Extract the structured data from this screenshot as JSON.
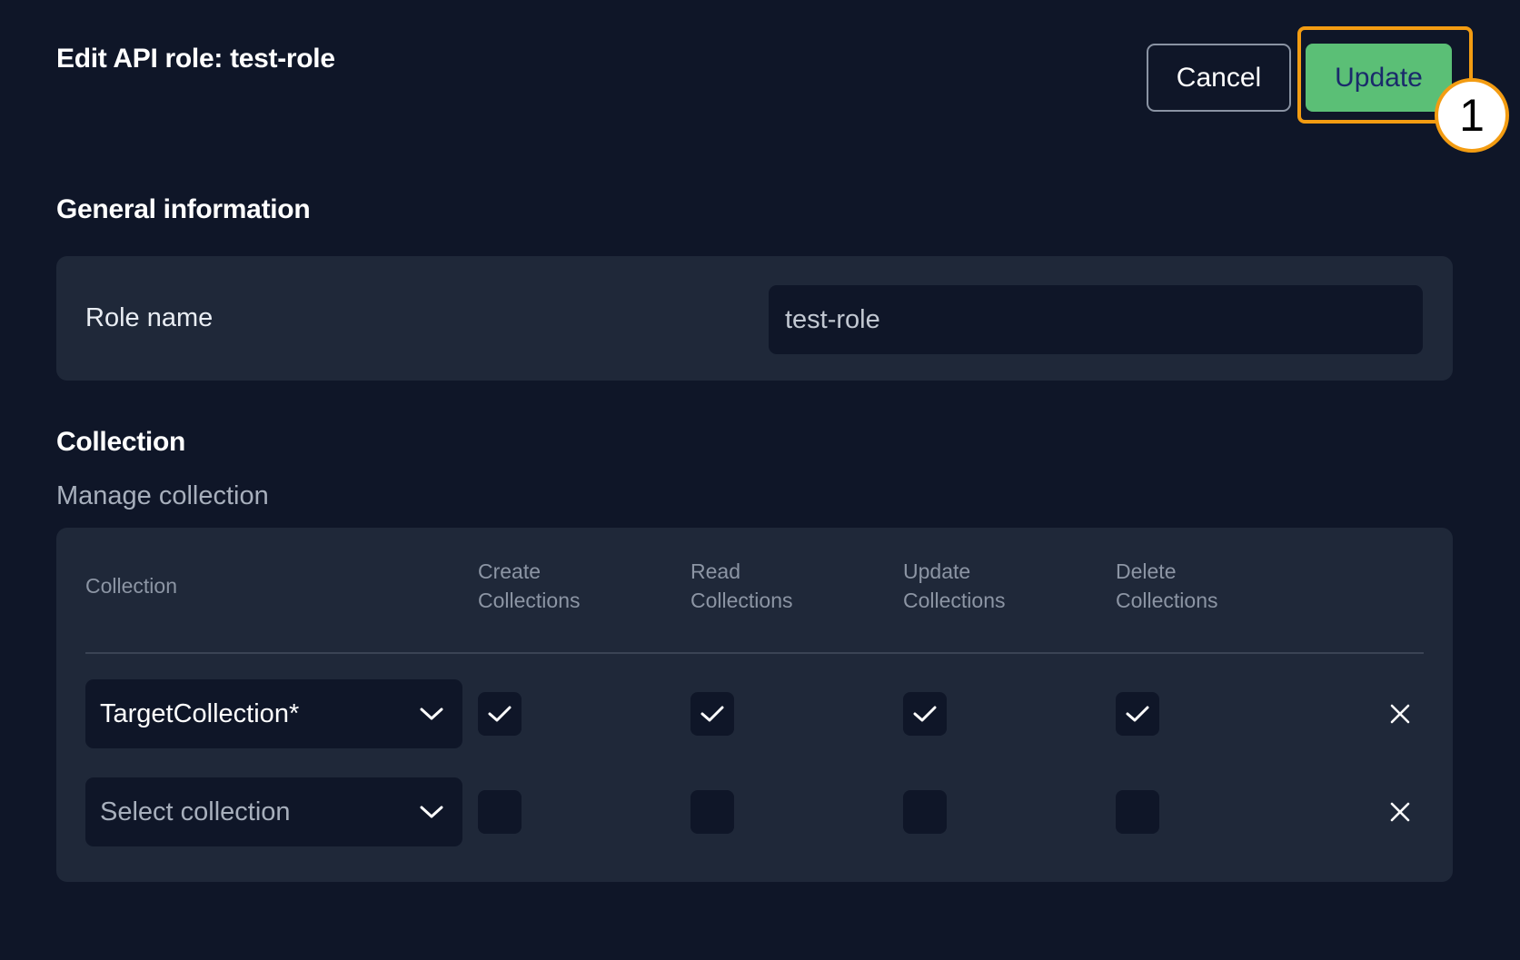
{
  "header": {
    "title": "Edit API role: test-role",
    "cancel_label": "Cancel",
    "update_label": "Update",
    "callout_number": "1"
  },
  "general": {
    "title": "General information",
    "role_name_label": "Role name",
    "role_name_value": "test-role"
  },
  "collection": {
    "title": "Collection",
    "subtitle": "Manage collection",
    "columns": {
      "collection": "Collection",
      "create_line1": "Create",
      "create_line2": "Collections",
      "read_line1": "Read",
      "read_line2": "Collections",
      "update_line1": "Update",
      "update_line2": "Collections",
      "delete_line1": "Delete",
      "delete_line2": "Collections"
    },
    "rows": [
      {
        "collection": "TargetCollection*",
        "create": true,
        "read": true,
        "update": true,
        "delete": true
      },
      {
        "collection": "Select collection",
        "create": false,
        "read": false,
        "update": false,
        "delete": false
      }
    ]
  },
  "colors": {
    "background": "#0f1628",
    "panel": "#1f2839",
    "update_button": "#5bbf76",
    "highlight": "#f39c12"
  }
}
